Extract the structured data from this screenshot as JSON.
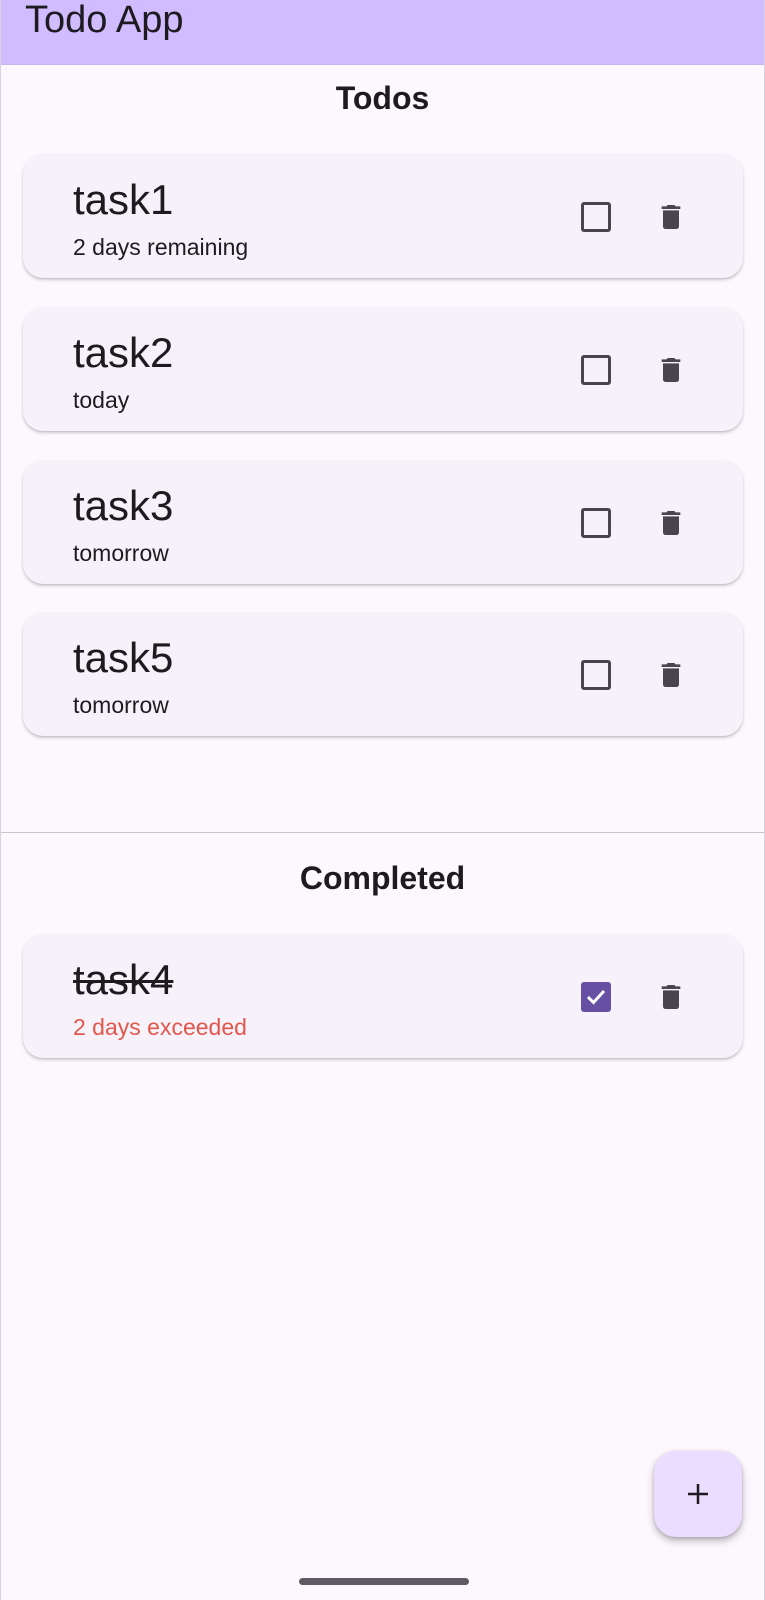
{
  "app_bar": {
    "title": "Todo App"
  },
  "todos_section": {
    "title": "Todos",
    "items": [
      {
        "title": "task1",
        "subtitle": "2 days remaining",
        "checked": false
      },
      {
        "title": "task2",
        "subtitle": "today",
        "checked": false
      },
      {
        "title": "task3",
        "subtitle": "tomorrow",
        "checked": false
      },
      {
        "title": "task5",
        "subtitle": "tomorrow",
        "checked": false
      }
    ]
  },
  "completed_section": {
    "title": "Completed",
    "items": [
      {
        "title": "task4",
        "subtitle": "2 days exceeded",
        "checked": true
      }
    ]
  },
  "fab": {
    "icon": "plus-icon"
  },
  "colors": {
    "app_bar": "#d0bcfe",
    "background": "#fdf7fe",
    "card": "#f7f2f9",
    "checkbox_checked": "#6750a4",
    "overdue_text": "#e2574c",
    "fab": "#eaddff"
  }
}
